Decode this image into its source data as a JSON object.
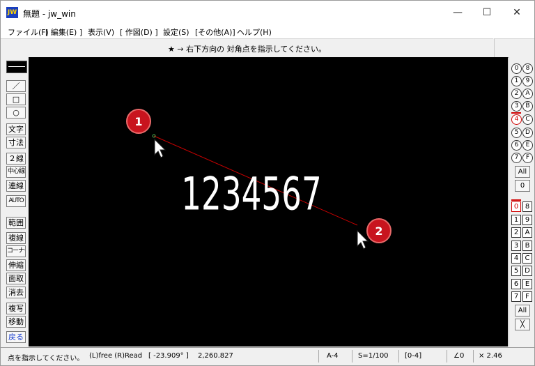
{
  "window": {
    "app_icon_text": "JW",
    "title": "無題 - jw_win",
    "minimize": "—",
    "maximize": "☐",
    "close": "✕"
  },
  "menu": [
    "ファイル(F)",
    "[ 編集(E) ]",
    "表示(V)",
    "[ 作図(D) ]",
    "設定(S)",
    "[その他(A)]",
    "ヘルプ(H)"
  ],
  "message": "★ → 右下方向の 対角点を指示してください。",
  "left_toolbar": [
    "／",
    "□",
    "○",
    "文字",
    "寸法",
    "２線",
    "中心線",
    "連線",
    "AUTO",
    "範囲",
    "複線",
    "コーナー",
    "伸縮",
    "面取",
    "消去",
    "複写",
    "移動",
    "戻る"
  ],
  "canvas": {
    "text": "1234567",
    "markers": [
      "1",
      "2"
    ]
  },
  "layer_groups": {
    "circles_left": [
      "0",
      "1",
      "2",
      "3",
      "4",
      "5",
      "6",
      "7"
    ],
    "circles_right": [
      "8",
      "9",
      "A",
      "B",
      "C",
      "D",
      "E",
      "F"
    ],
    "all_label": "All",
    "zero_label": "0"
  },
  "layers": {
    "squares_left": [
      "0",
      "1",
      "2",
      "3",
      "4",
      "5",
      "6",
      "7"
    ],
    "squares_right": [
      "8",
      "9",
      "A",
      "B",
      "C",
      "D",
      "E",
      "F"
    ],
    "all_label": "All",
    "cross_label": "╳"
  },
  "status": {
    "hint": "点を指示してください。",
    "mouse": "(L)free (R)Read",
    "angle": "[ -23.909° ]",
    "length": "2,260.827",
    "paper": "A-4",
    "scale": "S=1/100",
    "layer": "[0-4]",
    "angle_setting": "∠0",
    "zoom": "× 2.46"
  },
  "colors": {
    "canvas": "#000000",
    "rubber_line": "#cc0000",
    "marker": "#c8141e",
    "active_layer": "#d00000"
  }
}
